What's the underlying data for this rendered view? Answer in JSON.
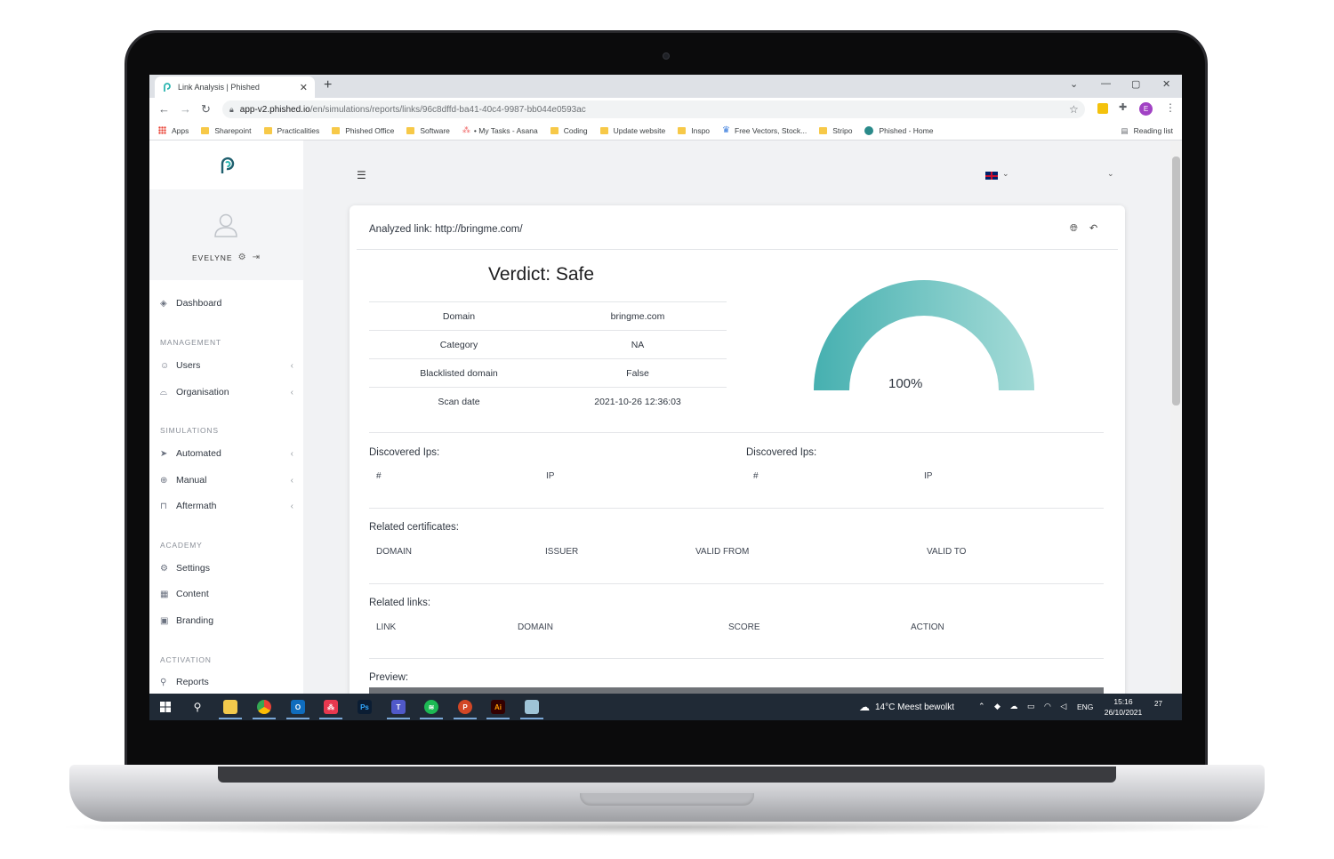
{
  "browser": {
    "tab_title": "Link Analysis | Phished",
    "tab_close": "✕",
    "new_tab": "+",
    "window_controls": [
      "⌄",
      "—",
      "▢",
      "✕"
    ],
    "url_host": "app-v2.phished.io",
    "url_path": "/en/simulations/reports/links/96c8dffd-ba41-40c4-9987-bb044e0593ac",
    "profile_initial": "E",
    "bookmarks": [
      {
        "label": "Apps",
        "icon": "apps-grid-icon"
      },
      {
        "label": "Sharepoint",
        "icon": "folder-icon"
      },
      {
        "label": "Practicalities",
        "icon": "folder-icon"
      },
      {
        "label": "Phished Office",
        "icon": "folder-icon"
      },
      {
        "label": "Software",
        "icon": "folder-icon"
      },
      {
        "label": "• My Tasks - Asana",
        "icon": "asana-icon"
      },
      {
        "label": "Coding",
        "icon": "folder-icon"
      },
      {
        "label": "Update website",
        "icon": "folder-icon"
      },
      {
        "label": "Inspo",
        "icon": "folder-icon"
      },
      {
        "label": "Free Vectors, Stock...",
        "icon": "vecteezy-icon"
      },
      {
        "label": "Stripo",
        "icon": "folder-icon"
      },
      {
        "label": "Phished - Home",
        "icon": "phished-icon"
      }
    ],
    "reading_list": "Reading list"
  },
  "sidebar": {
    "user_name": "EVELYNE",
    "items": {
      "dashboard": "Dashboard",
      "management": "MANAGEMENT",
      "users": "Users",
      "organisation": "Organisation",
      "simulations": "SIMULATIONS",
      "automated": "Automated",
      "manual": "Manual",
      "aftermath": "Aftermath",
      "academy": "ACADEMY",
      "settings": "Settings",
      "content": "Content",
      "branding": "Branding",
      "activation": "ACTIVATION",
      "reports": "Reports"
    }
  },
  "card": {
    "analyzed_link": "Analyzed link: http://bringme.com/",
    "verdict": "Verdict: Safe",
    "info": [
      {
        "key": "Domain",
        "value": "bringme.com"
      },
      {
        "key": "Category",
        "value": "NA"
      },
      {
        "key": "Blacklisted domain",
        "value": "False"
      },
      {
        "key": "Scan date",
        "value": "2021-10-26 12:36:03"
      }
    ],
    "gauge": {
      "value_percent": 100,
      "label": "100%",
      "color_start": "#46b0b0",
      "color_end": "#a6dcd8"
    },
    "discovered_ips_left": {
      "title": "Discovered Ips:",
      "col_num": "#",
      "col_ip": "IP"
    },
    "discovered_ips_right": {
      "title": "Discovered Ips:",
      "col_num": "#",
      "col_ip": "IP"
    },
    "certificates": {
      "title": "Related certificates:",
      "cols": [
        "DOMAIN",
        "ISSUER",
        "VALID FROM",
        "VALID TO"
      ]
    },
    "links": {
      "title": "Related links:",
      "cols": [
        "LINK",
        "DOMAIN",
        "SCORE",
        "ACTION"
      ]
    },
    "preview": {
      "title": "Preview:"
    }
  },
  "taskbar": {
    "weather": "14°C  Meest bewolkt",
    "tray_icons": "⌃ ◆ ☁ ▭ ◠ ◁",
    "language": "ENG",
    "time": "15:16",
    "date": "26/10/2021",
    "notifications": "27"
  },
  "colors": {
    "accent": "#46b0b0",
    "taskbar": "#202a36"
  }
}
